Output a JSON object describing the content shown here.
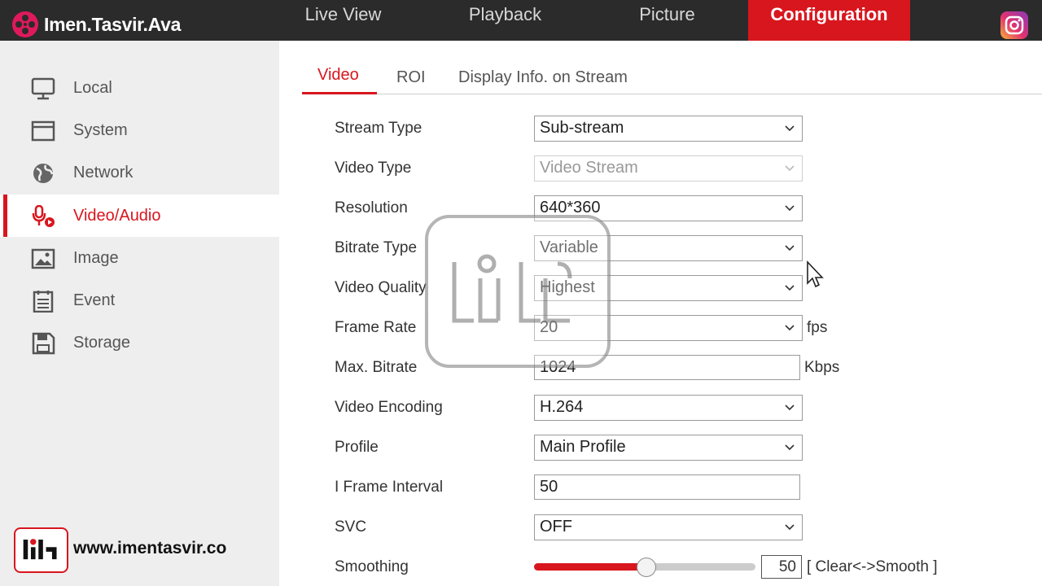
{
  "brand": {
    "name": "Imen.Tasvir.Ava"
  },
  "topnav": {
    "items": [
      "Live View",
      "Playback",
      "Picture",
      "Configuration"
    ],
    "active": "Configuration"
  },
  "sidebar": {
    "items": [
      {
        "label": "Local",
        "icon": "monitor-icon"
      },
      {
        "label": "System",
        "icon": "window-icon"
      },
      {
        "label": "Network",
        "icon": "globe-icon"
      },
      {
        "label": "Video/Audio",
        "icon": "microphone-video-icon"
      },
      {
        "label": "Image",
        "icon": "image-icon"
      },
      {
        "label": "Event",
        "icon": "calendar-list-icon"
      },
      {
        "label": "Storage",
        "icon": "floppy-disk-icon"
      }
    ],
    "active": "Video/Audio"
  },
  "tabs": {
    "items": [
      "Video",
      "ROI",
      "Display Info. on Stream"
    ],
    "active": "Video"
  },
  "form": {
    "stream_type": {
      "label": "Stream Type",
      "value": "Sub-stream"
    },
    "video_type": {
      "label": "Video Type",
      "value": "Video Stream"
    },
    "resolution": {
      "label": "Resolution",
      "value": "640*360"
    },
    "bitrate_type": {
      "label": "Bitrate Type",
      "value": "Variable"
    },
    "video_quality": {
      "label": "Video Quality",
      "value": "Highest"
    },
    "frame_rate": {
      "label": "Frame Rate",
      "value": "20",
      "unit": "fps"
    },
    "max_bitrate": {
      "label": "Max. Bitrate",
      "value": "1024",
      "unit": "Kbps"
    },
    "video_encoding": {
      "label": "Video Encoding",
      "value": "H.264"
    },
    "profile": {
      "label": "Profile",
      "value": "Main Profile"
    },
    "i_frame_interval": {
      "label": "I Frame Interval",
      "value": "50"
    },
    "svc": {
      "label": "SVC",
      "value": "OFF"
    },
    "smoothing": {
      "label": "Smoothing",
      "value": "50",
      "hint": "[ Clear<->Smooth ]",
      "level_percent": 50
    }
  },
  "footer": {
    "url": "www.imentasvir.co"
  },
  "colors": {
    "accent": "#d8161e",
    "topbar": "#2b2b2b",
    "sidebar": "#eeeeee"
  }
}
